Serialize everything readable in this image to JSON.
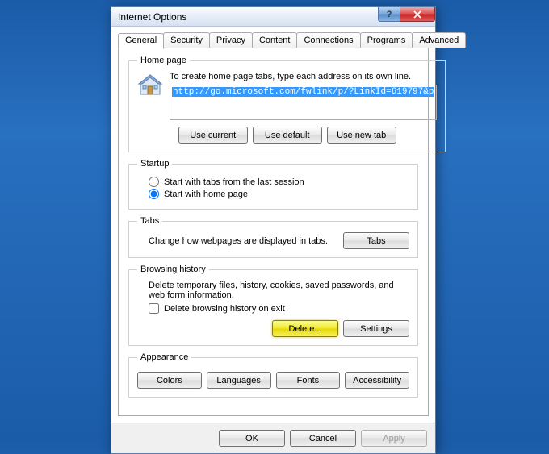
{
  "dialog": {
    "title": "Internet Options"
  },
  "tabs": {
    "general": "General",
    "security": "Security",
    "privacy": "Privacy",
    "content": "Content",
    "connections": "Connections",
    "programs": "Programs",
    "advanced": "Advanced"
  },
  "homepage": {
    "legend": "Home page",
    "desc": "To create home page tabs, type each address on its own line.",
    "url": "http://go.microsoft.com/fwlink/p/?LinkId=619797&p",
    "use_current": "Use current",
    "use_default": "Use default",
    "use_new_tab": "Use new tab"
  },
  "startup": {
    "legend": "Startup",
    "opt_last": "Start with tabs from the last session",
    "opt_home": "Start with home page"
  },
  "tab_section": {
    "legend": "Tabs",
    "desc": "Change how webpages are displayed in tabs.",
    "tabs_btn": "Tabs"
  },
  "history": {
    "legend": "Browsing history",
    "desc": "Delete temporary files, history, cookies, saved passwords, and web form information.",
    "del_on_exit": "Delete browsing history on exit",
    "delete_btn": "Delete...",
    "settings_btn": "Settings"
  },
  "appearance": {
    "legend": "Appearance",
    "colors": "Colors",
    "languages": "Languages",
    "fonts": "Fonts",
    "accessibility": "Accessibility"
  },
  "bottom": {
    "ok": "OK",
    "cancel": "Cancel",
    "apply": "Apply"
  }
}
